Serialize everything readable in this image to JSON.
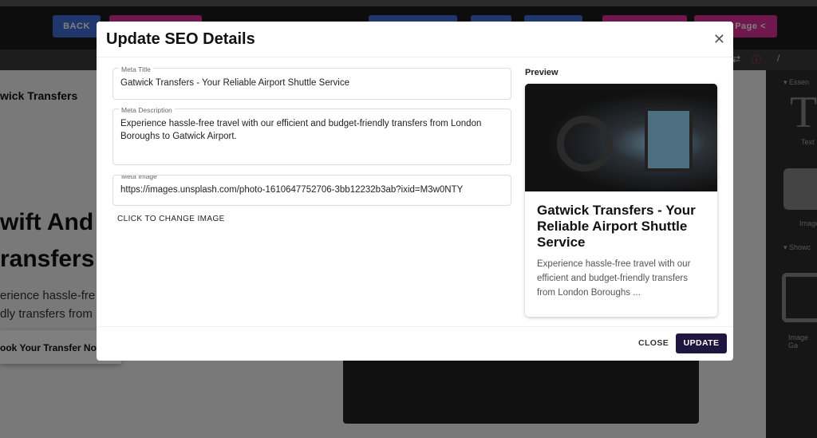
{
  "topbar": {
    "back": "BACK",
    "page_share": "Page"
  },
  "page": {
    "brand": "wick Transfers",
    "hero1": "wift And",
    "hero2": "ransfers",
    "body1": "erience hassle-fre",
    "body2": "dly transfers from",
    "cta": "ook Your Transfer No"
  },
  "sidebar": {
    "section1": "Essen",
    "text": "Text",
    "image": "Image",
    "section2": "Showc",
    "gallery": "Image Ga"
  },
  "modal": {
    "title": "Update SEO Details",
    "meta_title_label": "Meta Title",
    "meta_title": "Gatwick Transfers - Your Reliable Airport Shuttle Service",
    "meta_desc_label": "Meta Description",
    "meta_desc": "Experience hassle-free travel with our efficient and budget-friendly transfers from London Boroughs to Gatwick Airport.",
    "meta_image_label": "Meta Image",
    "meta_image": "https://images.unsplash.com/photo-1610647752706-3bb12232b3ab?ixid=M3w0NTY",
    "change_image": "CLICK TO CHANGE IMAGE",
    "preview_label": "Preview",
    "preview_title": "Gatwick Transfers - Your Reliable Airport Shuttle Service",
    "preview_desc": "Experience hassle-free travel with our efficient and budget-friendly transfers from London Boroughs ...",
    "close": "CLOSE",
    "update": "UPDATE"
  }
}
